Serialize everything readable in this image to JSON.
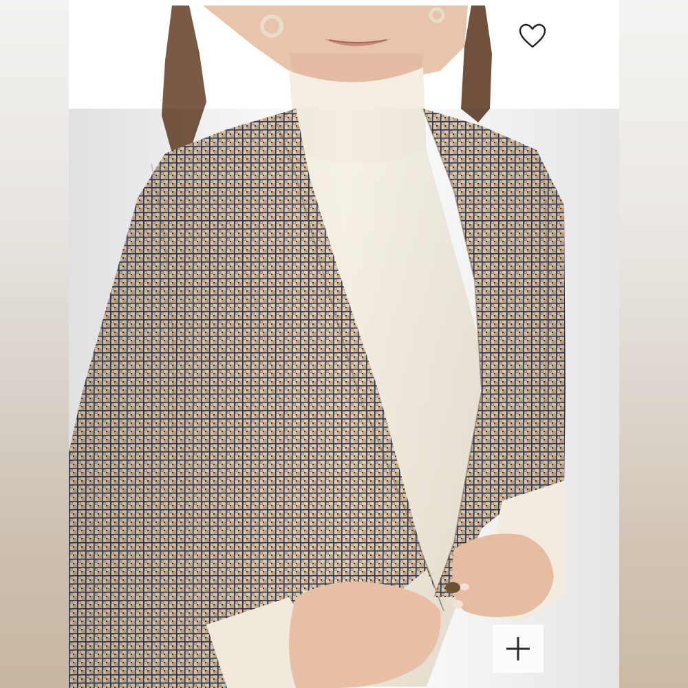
{
  "product_image": {
    "alt": ""
  },
  "actions": {
    "wishlist": {
      "icon": "heart-outline-icon",
      "state": "not-saved"
    },
    "zoom": {
      "icon": "plus-icon"
    }
  },
  "colors": {
    "blazer_base": "#d9cbb6",
    "blazer_navy": "#2e3a55",
    "blazer_tan": "#b48a5a",
    "turtleneck": "#f2ece0",
    "hair": "#7a5a44",
    "skin": "#e9c4ad"
  }
}
